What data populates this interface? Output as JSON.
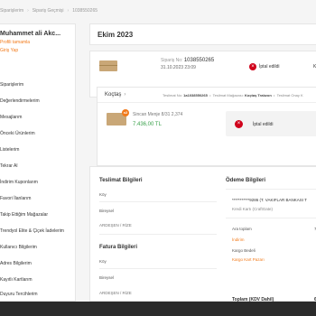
{
  "breadcrumb": {
    "item1": "Siparişlerim",
    "item2": "Sipariş Geçmişi",
    "item3": "1038550265"
  },
  "sidebar": {
    "name": "Muhammet ali Akc...",
    "link1": "Profili tamamla",
    "link2": "Giriş Yap",
    "items": [
      "Siparişlerim",
      "Değerlendirmelerim",
      "Mesajlarım",
      "Önceki Ürünlerim",
      "Listelerim",
      "Tekrar Al",
      "İndirim Kuponlarım",
      "Favori İlanlarım",
      "Takip Ettiğim Mağazalar",
      "Trendyol Elite & Çiçek İadelerim",
      "Kullanıcı Bilgilerim",
      "Adres Bilgilerim",
      "Kayıtlı Kartlarım",
      "Duyuru Tercihlerim",
      "Şifre Değiştirme"
    ]
  },
  "main": {
    "title": "Ekim 2023",
    "summary": {
      "order_label": "Sipariş No:",
      "order_no": "1038550265",
      "date": "31.10.2023 23:09",
      "status": "İptal edildi",
      "status_extra": "K"
    },
    "shipment": {
      "seller": "Koçtaş",
      "meta_no_label": "Teslimat No:",
      "meta_no": "1a1038550265",
      "meta_store_label": "Teslimat Mağazası:",
      "meta_store": "Koçtaş Trabzon",
      "meta_track": "Teslimat Onay K",
      "qty": "x2",
      "product_name": "Sincan Menje 8/31 2,374",
      "price": "7.436,00 TL",
      "cancel_text": "İptal edildi"
    },
    "delivery": {
      "title": "Teslimat Bilgileri",
      "name": "Köy",
      "line2": "Bireysel",
      "line3": "ARDEŞEN / RİZE"
    },
    "invoice": {
      "title": "Fatura Bilgileri",
      "name": "Köy",
      "line2": "Bireysel",
      "line3": "ARDEŞEN / RİZE"
    },
    "payment": {
      "title": "Ödeme Bilgileri",
      "card": "***********9286 (T. VAKIFLAR BANKASI T",
      "card_type": "Kredi Kartı (CraftGate)",
      "subtotal_label": "Ara toplam",
      "discount_label": "İndirim",
      "shipping_label": "Kargo Bedeli",
      "free_shipping_label": "Kargo Kart Pazarı",
      "total_label": "Toplam (KDV Dahil)",
      "subtotal_val": "7",
      "total_val": "6"
    }
  },
  "colors": {
    "accent": "#f27a1a",
    "danger": "#d0021b",
    "price": "#39a04a"
  }
}
